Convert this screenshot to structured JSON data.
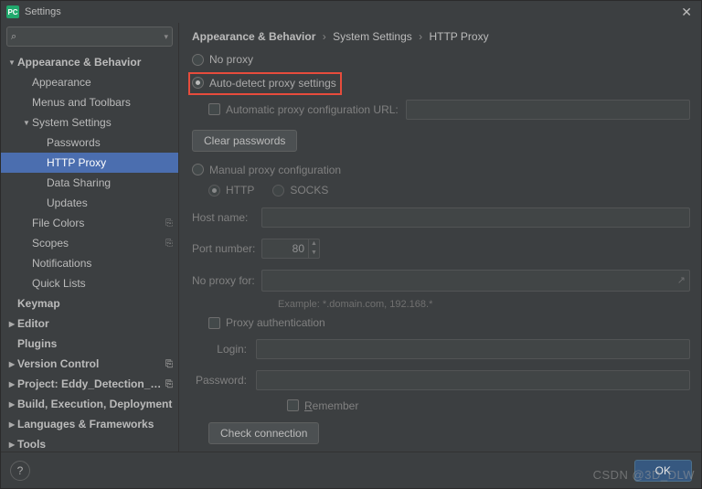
{
  "window": {
    "title": "Settings",
    "icon_text": "PC"
  },
  "search": {
    "placeholder": ""
  },
  "sidebar": [
    {
      "label": "Appearance & Behavior",
      "level": 0,
      "expanded": true,
      "bold": true,
      "arrow": true
    },
    {
      "label": "Appearance",
      "level": 1
    },
    {
      "label": "Menus and Toolbars",
      "level": 1
    },
    {
      "label": "System Settings",
      "level": 1,
      "expanded": true,
      "arrow": true
    },
    {
      "label": "Passwords",
      "level": 2
    },
    {
      "label": "HTTP Proxy",
      "level": 2,
      "selected": true
    },
    {
      "label": "Data Sharing",
      "level": 2
    },
    {
      "label": "Updates",
      "level": 2
    },
    {
      "label": "File Colors",
      "level": 1,
      "proj": true
    },
    {
      "label": "Scopes",
      "level": 1,
      "proj": true
    },
    {
      "label": "Notifications",
      "level": 1
    },
    {
      "label": "Quick Lists",
      "level": 1
    },
    {
      "label": "Keymap",
      "level": 0,
      "bold": true
    },
    {
      "label": "Editor",
      "level": 0,
      "bold": true,
      "arrow": true,
      "collapsed": true
    },
    {
      "label": "Plugins",
      "level": 0,
      "bold": true
    },
    {
      "label": "Version Control",
      "level": 0,
      "bold": true,
      "arrow": true,
      "collapsed": true,
      "proj": true
    },
    {
      "label": "Project: Eddy_Detection_Tracki...",
      "level": 0,
      "bold": true,
      "arrow": true,
      "collapsed": true,
      "proj": true
    },
    {
      "label": "Build, Execution, Deployment",
      "level": 0,
      "bold": true,
      "arrow": true,
      "collapsed": true
    },
    {
      "label": "Languages & Frameworks",
      "level": 0,
      "bold": true,
      "arrow": true,
      "collapsed": true
    },
    {
      "label": "Tools",
      "level": 0,
      "bold": true,
      "arrow": true,
      "collapsed": true
    }
  ],
  "crumbs": [
    "Appearance & Behavior",
    "System Settings",
    "HTTP Proxy"
  ],
  "proxy": {
    "no_proxy": "No proxy",
    "auto_detect": "Auto-detect proxy settings",
    "auto_url": "Automatic proxy configuration URL:",
    "clear_passwords": "Clear passwords",
    "manual": "Manual proxy configuration",
    "http": "HTTP",
    "socks": "SOCKS",
    "host": "Host name:",
    "port": "Port number:",
    "port_value": "80",
    "no_proxy_for": "No proxy for:",
    "example": "Example: *.domain.com, 192.168.*",
    "proxy_auth": "Proxy authentication",
    "login": "Login:",
    "password": "Password:",
    "remember": "Remember",
    "check": "Check connection"
  },
  "footer": {
    "ok": "OK",
    "help": "?"
  },
  "watermark": "CSDN @3D_DLW"
}
